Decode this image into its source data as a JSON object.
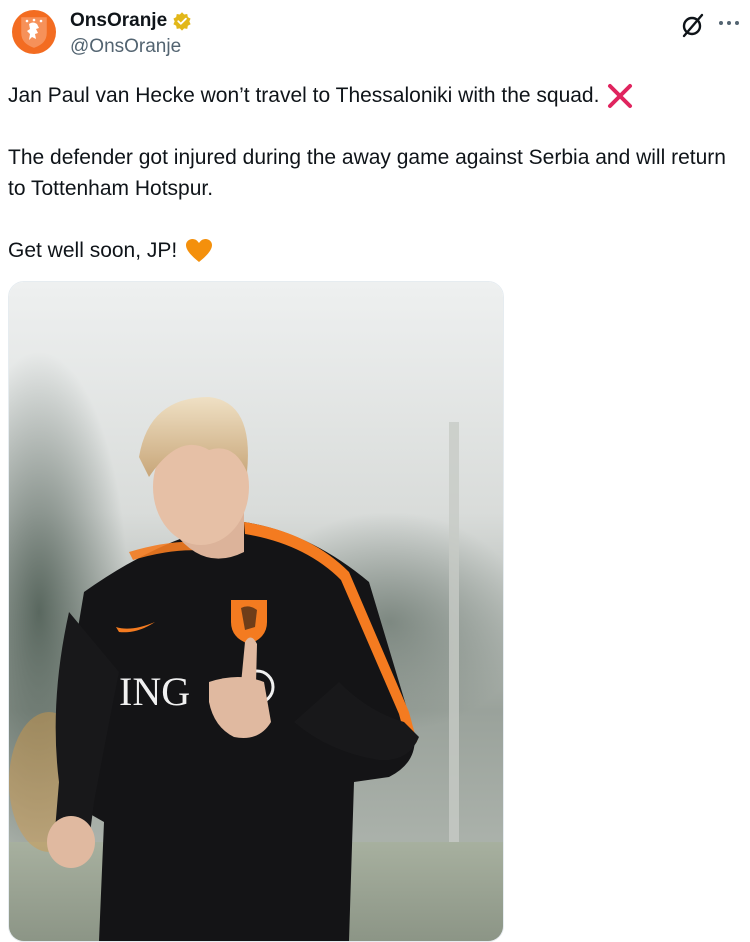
{
  "account": {
    "display_name": "OnsOranje",
    "handle": "@OnsOranje",
    "avatar_icon": "knvb-lion-crest-icon",
    "verified_icon": "verified-badge-icon",
    "verified_color": "#e2b719",
    "brand_color": "#f36c21"
  },
  "toolbar": {
    "grok_icon": "grok-icon",
    "more_icon": "more-options-icon"
  },
  "tweet": {
    "line1": "Jan Paul van Hecke won’t travel to Thessaloniki with the squad.",
    "line1_emoji": "cross-mark-emoji",
    "line2": "The defender got injured during the away game against Serbia and will return to Tottenham Hotspur.",
    "line3": "Get well soon, JP!",
    "line3_emoji": "orange-heart-emoji"
  },
  "media": {
    "type": "photo",
    "shirt_text": "ING"
  }
}
